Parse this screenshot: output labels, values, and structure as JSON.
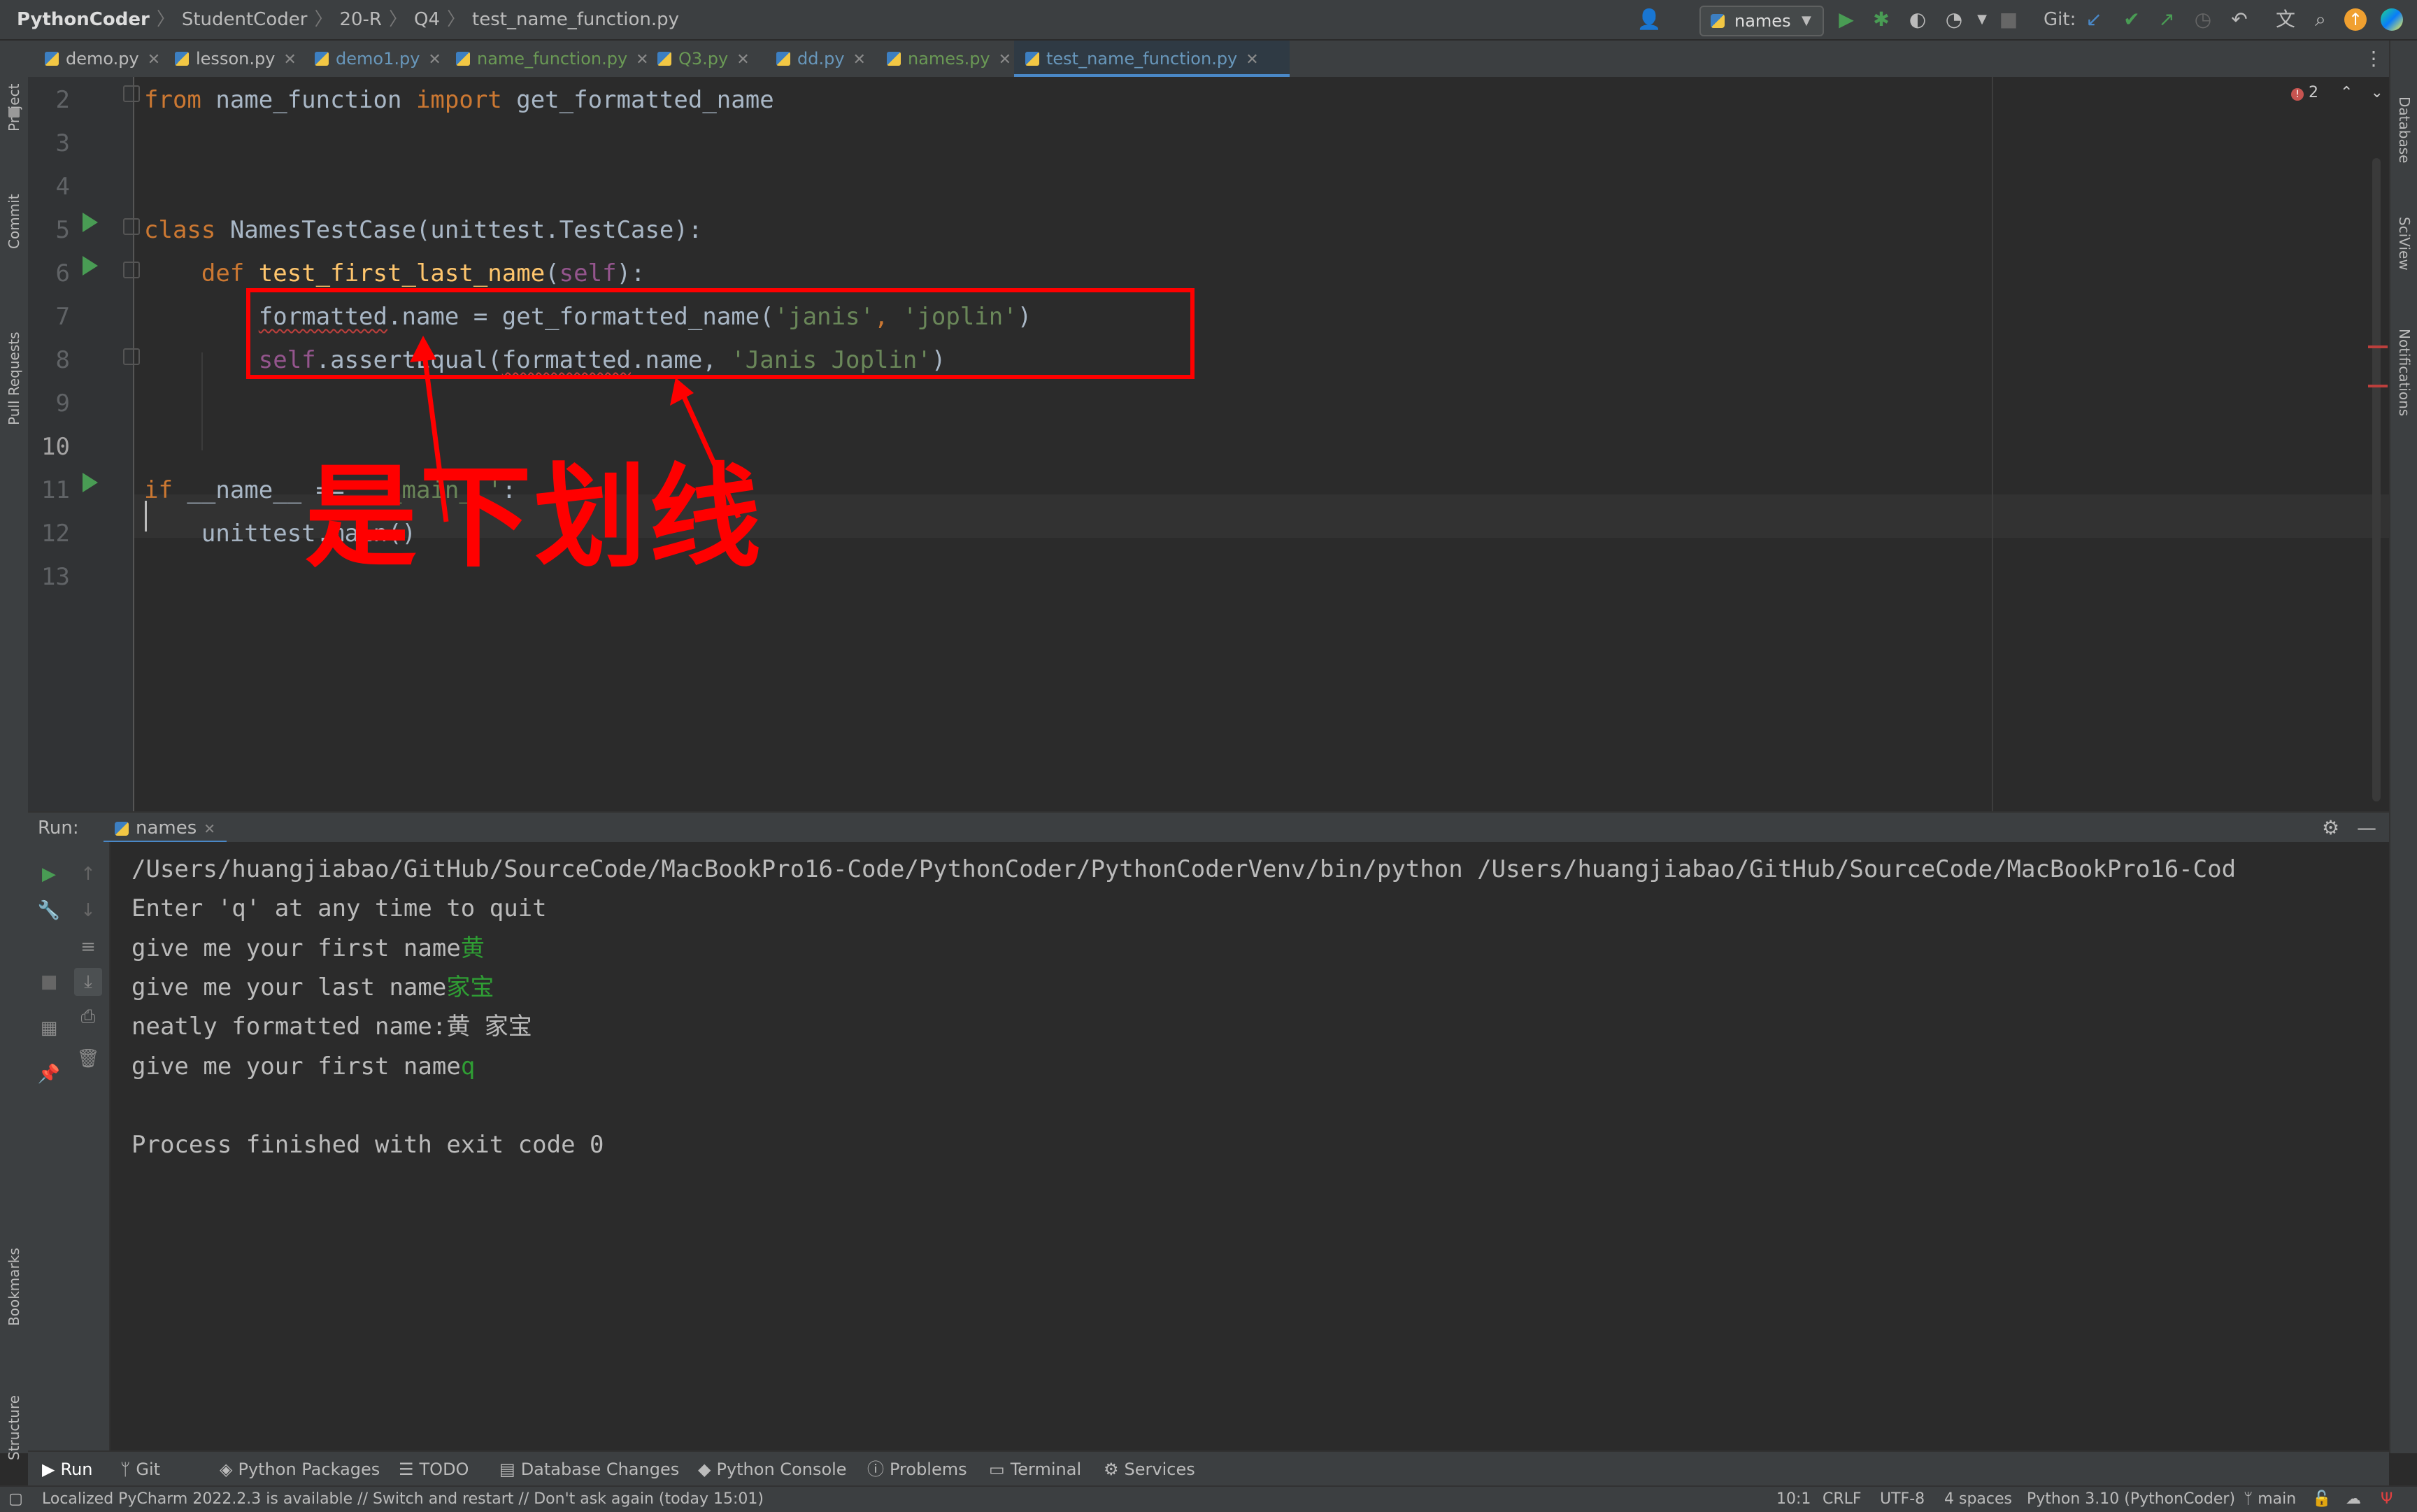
{
  "breadcrumb": [
    "PythonCoder",
    "StudentCoder",
    "20-R",
    "Q4",
    "test_name_function.py"
  ],
  "toolbar": {
    "run_config": "names",
    "git_label": "Git:"
  },
  "tabs": [
    {
      "label": "demo.py"
    },
    {
      "label": "lesson.py"
    },
    {
      "label": "demo1.py"
    },
    {
      "label": "name_function.py"
    },
    {
      "label": "Q3.py"
    },
    {
      "label": "dd.py"
    },
    {
      "label": "names.py"
    },
    {
      "label": "test_name_function.py",
      "active": true
    }
  ],
  "left_tools": [
    "Project",
    "Commit",
    "Pull Requests",
    "Bookmarks",
    "Structure"
  ],
  "right_tools": [
    "Database",
    "SciView",
    "Notifications"
  ],
  "editor": {
    "problem_count": "2",
    "lines": [
      {
        "n": "2",
        "parts": [
          [
            "kw",
            "from "
          ],
          [
            "",
            "name_function "
          ],
          [
            "kw",
            "import "
          ],
          [
            "",
            "get_formatted_name"
          ]
        ]
      },
      {
        "n": "3",
        "parts": []
      },
      {
        "n": "4",
        "parts": []
      },
      {
        "n": "5",
        "parts": [
          [
            "kw",
            "class "
          ],
          [
            "",
            "NamesTestCase(unittest.TestCase):"
          ]
        ]
      },
      {
        "n": "6",
        "parts": [
          [
            "",
            "    "
          ],
          [
            "kw",
            "def "
          ],
          [
            "fn",
            "test_first_last_name"
          ],
          [
            "",
            "("
          ],
          [
            "self",
            "self"
          ],
          [
            "",
            "):"
          ]
        ]
      },
      {
        "n": "7",
        "parts": [
          [
            "",
            "        "
          ],
          [
            "wave",
            "formatted"
          ],
          [
            "",
            ".name = get_formatted_name("
          ],
          [
            "str",
            "'janis'"
          ],
          [
            "kw",
            ", "
          ],
          [
            "str",
            "'joplin'"
          ],
          [
            "",
            ")"
          ]
        ]
      },
      {
        "n": "8",
        "parts": [
          [
            "",
            "        "
          ],
          [
            "self",
            "self"
          ],
          [
            "",
            ".assertEqual("
          ],
          [
            "wave",
            "formatted"
          ],
          [
            "",
            ".name, "
          ],
          [
            "str",
            "'Janis Joplin'"
          ],
          [
            "",
            ")"
          ]
        ]
      },
      {
        "n": "9",
        "parts": []
      },
      {
        "n": "10",
        "parts": []
      },
      {
        "n": "11",
        "parts": [
          [
            "kw",
            "if "
          ],
          [
            "",
            "__name__ == "
          ],
          [
            "str",
            "'__main__'"
          ],
          [
            "",
            ":"
          ]
        ]
      },
      {
        "n": "12",
        "parts": [
          [
            "",
            "    unittest.main()"
          ]
        ]
      },
      {
        "n": "13",
        "parts": []
      }
    ]
  },
  "annotation": {
    "text": "是下划线"
  },
  "run_panel": {
    "title": "Run:",
    "tab": "names"
  },
  "console": {
    "lines": [
      {
        "text": "/Users/huangjiabao/GitHub/SourceCode/MacBookPro16-Code/PythonCoder/PythonCoderVenv/bin/python /Users/huangjiabao/GitHub/SourceCode/MacBookPro16-Cod",
        "input": ""
      },
      {
        "text": "Enter 'q' at any time to quit",
        "input": ""
      },
      {
        "text": "give me your first name",
        "input": "黄"
      },
      {
        "text": "give me your last name",
        "input": "家宝"
      },
      {
        "text": "neatly formatted name:黄 家宝",
        "input": ""
      },
      {
        "text": "give me your first name",
        "input": "q"
      },
      {
        "text": "",
        "input": ""
      },
      {
        "text": "Process finished with exit code 0",
        "input": ""
      }
    ]
  },
  "bottom_tabs": [
    "Run",
    "Git",
    "Python Packages",
    "TODO",
    "Database Changes",
    "Python Console",
    "Problems",
    "Terminal",
    "Services"
  ],
  "status": {
    "message": "Localized PyCharm 2022.2.3 is available // Switch and restart // Don't ask again (today 15:01)",
    "position": "10:1",
    "line_sep": "CRLF",
    "encoding": "UTF-8",
    "indent": "4 spaces",
    "interpreter": "Python 3.10 (PythonCoder)",
    "branch": "main"
  },
  "colors": {
    "accent": "#4a88c7",
    "error": "#ff0000",
    "run_green": "#499c54"
  }
}
